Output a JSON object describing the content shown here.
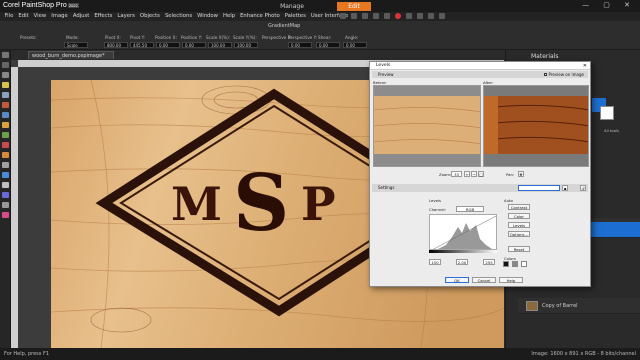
{
  "app": {
    "brand": "Corel PaintShop Pro",
    "version": "2022",
    "workspace_tabs": [
      "Manage",
      "Edit"
    ],
    "active_workspace": "Edit"
  },
  "menu": [
    "File",
    "Edit",
    "View",
    "Image",
    "Adjust",
    "Effects",
    "Layers",
    "Objects",
    "Selections",
    "Window",
    "Help",
    "Enhance Photo",
    "Palettes",
    "User Interface"
  ],
  "tool_options": {
    "labels": [
      "Presets:",
      "Mode:",
      "Pivot X:",
      "Pivot Y:",
      "Position X:",
      "Position Y:",
      "Scale X(%):",
      "Scale Y(%):",
      "Perspective X:",
      "Perspective Y:",
      "Shear:",
      "Angle:"
    ],
    "mode_value": "Scale",
    "values": [
      "800.00",
      "445.50",
      "0.00",
      "0.00",
      "100.00",
      "100.00",
      "0.00",
      "0.00",
      "0.00",
      "0.00"
    ],
    "gradient_map": "GradientMap"
  },
  "document": {
    "tab_label": "wood_burn_demo.pspimage*"
  },
  "canvas_text": "MSP",
  "right_panel": {
    "materials_title": "Materials",
    "all_tools": "All tools",
    "layers": [
      "Copy of Barrel"
    ]
  },
  "dialog": {
    "title": "Levels",
    "preview_section": "Preview",
    "preview_on_image": "Preview on image",
    "before_label": "Before:",
    "after_label": "After:",
    "zoom_label": "Zoom:",
    "zoom_value": "33",
    "pan_label": "Pan:",
    "settings_label": "Settings",
    "levels_label": "Levels",
    "channel_label": "Channel:",
    "channel_value": "RGB",
    "auto_label": "Auto",
    "auto_buttons": [
      "Contrast",
      "Color",
      "Levels",
      "Options..."
    ],
    "reset_label": "Reset",
    "colors_label": "Colors",
    "inputs": [
      "150",
      "2.00",
      "255"
    ],
    "ok": "OK",
    "cancel": "Cancel",
    "help": "Help"
  },
  "status": {
    "left": "For Help, press F1",
    "right": "Image: 1600 x 891 x RGB - 8 bits/channel"
  },
  "colors": {
    "accent": "#e87722",
    "selection_blue": "#1c6fd1",
    "wood_light": "#e2b883",
    "wood_dark": "#a05a1e",
    "burn": "#2a120a"
  }
}
